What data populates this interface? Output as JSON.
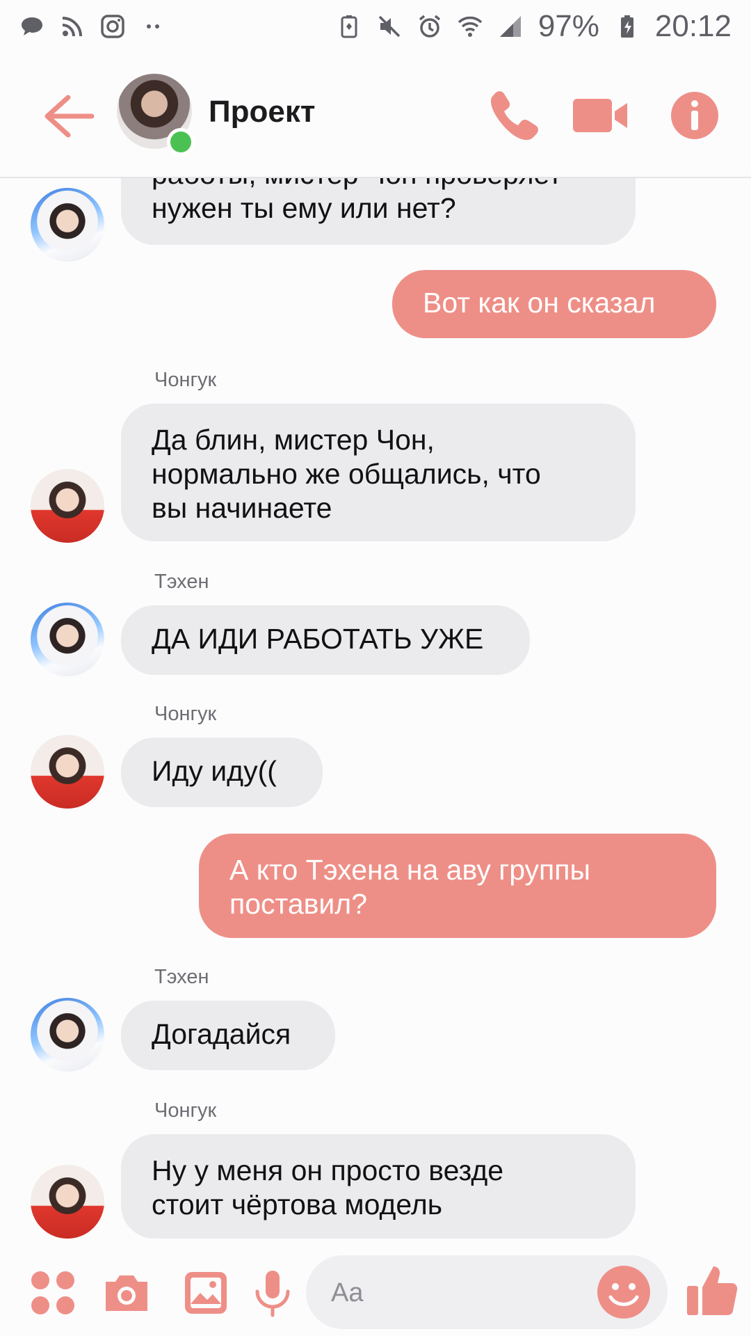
{
  "status_bar": {
    "battery": "97%",
    "time": "20:12",
    "left_icons": [
      "messages-icon",
      "rss-icon",
      "instagram-icon",
      "more-dots-icon"
    ],
    "right_icons": [
      "battery-saver-icon",
      "mute-icon",
      "alarm-icon",
      "wifi-icon",
      "signal-icon",
      "battery-icon"
    ]
  },
  "header": {
    "title": "Проект",
    "online": true
  },
  "messages": [
    {
      "side": "in",
      "sender": "",
      "lines": [
        "работы, мистер Чон проверяет",
        "нужен ты ему или нет?"
      ],
      "avatar": "taehyung"
    },
    {
      "side": "out",
      "text": "Вот как он сказал"
    },
    {
      "side": "in",
      "sender": "Чонгук",
      "lines": [
        "Да блин, мистер Чон,",
        "нормально же общались, что",
        "вы начинаете"
      ],
      "avatar": "jungkook"
    },
    {
      "side": "in",
      "sender": "Тэхен",
      "lines": [
        "ДА ИДИ РАБОТАТЬ УЖЕ"
      ],
      "avatar": "taehyung"
    },
    {
      "side": "in",
      "sender": "Чонгук",
      "lines": [
        "Иду иду(("
      ],
      "avatar": "jungkook"
    },
    {
      "side": "out",
      "lines": [
        "А кто Тэхена на аву группы",
        "поставил?"
      ]
    },
    {
      "side": "in",
      "sender": "Тэхен",
      "lines": [
        "Догадайся"
      ],
      "avatar": "taehyung"
    },
    {
      "side": "in",
      "sender": "Чонгук",
      "lines": [
        "Ну у меня он просто везде",
        "стоит чёртова модель"
      ],
      "avatar": "jungkook"
    }
  ],
  "composer": {
    "placeholder": "Aa"
  },
  "colors": {
    "accent": "#ee8f87",
    "incoming_bubble": "#ebebee",
    "online": "#4cc153"
  }
}
